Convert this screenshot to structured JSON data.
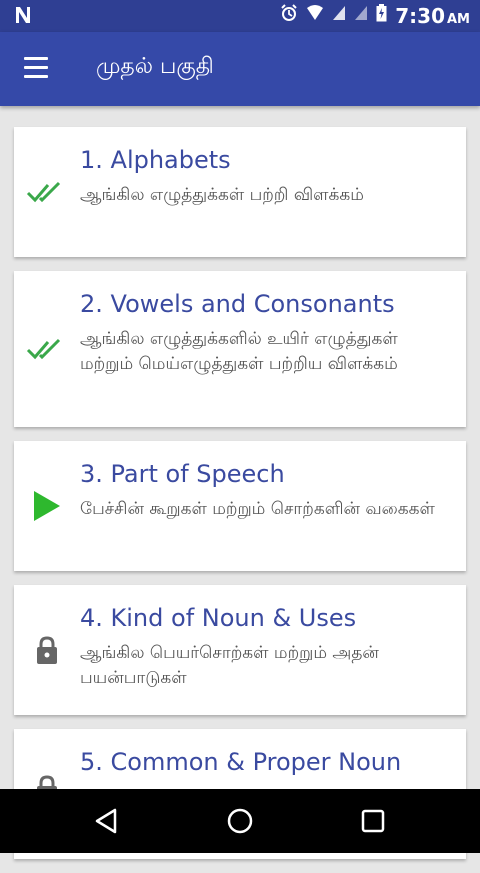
{
  "status_bar": {
    "notification_icon": "n-icon",
    "time": "7:30",
    "ampm": "AM"
  },
  "app_bar": {
    "title": "முதல் பகுதி"
  },
  "lessons": [
    {
      "title": "1. Alphabets",
      "description": "ஆங்கில எழுத்துக்கள் பற்றி விளக்கம்",
      "status": "completed",
      "icon": "double-check-icon"
    },
    {
      "title": "2. Vowels and Consonants",
      "description": "ஆங்கில எழுத்துக்களில் உயிர் எழுத்துகள் மற்றும் மெய்எழுத்துகள் பற்றிய விளக்கம்",
      "status": "completed",
      "icon": "double-check-icon"
    },
    {
      "title": "3. Part of Speech",
      "description": "பேச்சின் கூறுகள் மற்றும் சொற்களின் வகைகள்",
      "status": "current",
      "icon": "play-icon"
    },
    {
      "title": "4. Kind of Noun & Uses",
      "description": "ஆங்கில பெயர்சொற்கள் மற்றும் அதன் பயன்பாடுகள்",
      "status": "locked",
      "icon": "lock-icon"
    },
    {
      "title": "5. Common & Proper Noun",
      "description": "",
      "status": "locked",
      "icon": "lock-icon"
    }
  ],
  "colors": {
    "status_bar": "#2f3f93",
    "app_bar": "#3549a8",
    "title_text": "#3a4aa0",
    "check_green": "#3aa84a",
    "play_green": "#2eb82e",
    "lock_gray": "#666666"
  }
}
